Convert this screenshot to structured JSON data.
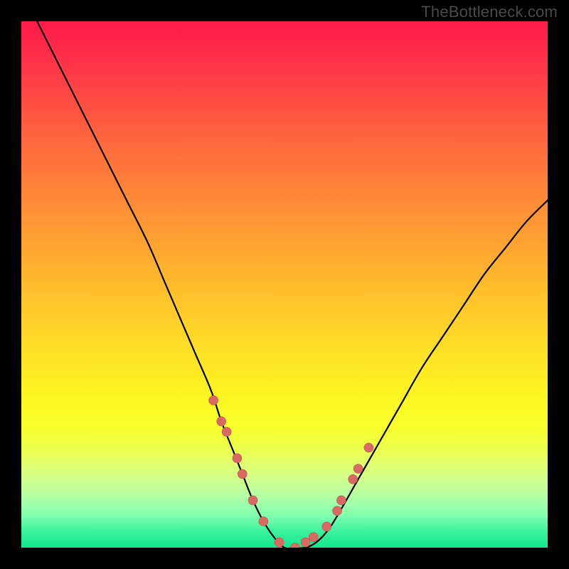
{
  "watermark": {
    "text": "TheBottleneck.com"
  },
  "colors": {
    "curve_stroke": "#000000",
    "marker_fill": "#d96a63",
    "marker_stroke": "#b75550"
  },
  "chart_data": {
    "type": "line",
    "title": "",
    "xlabel": "",
    "ylabel": "",
    "xlim": [
      0,
      100
    ],
    "ylim": [
      0,
      100
    ],
    "grid": false,
    "series": [
      {
        "name": "bottleneck-curve",
        "x": [
          3,
          8,
          12,
          16,
          20,
          24,
          27,
          30,
          33,
          36,
          38,
          40,
          42,
          44,
          46,
          48,
          50,
          52,
          54,
          56,
          58,
          60,
          64,
          68,
          72,
          76,
          80,
          84,
          88,
          92,
          96,
          100
        ],
        "y": [
          100,
          90,
          82,
          74,
          66,
          58,
          51,
          44,
          37,
          30,
          24,
          19,
          14,
          9,
          5,
          2,
          0,
          0,
          0,
          1,
          3,
          6,
          13,
          20,
          27,
          34,
          40,
          46,
          52,
          57,
          62,
          66
        ]
      }
    ],
    "markers": {
      "name": "highlight-points",
      "x": [
        36.5,
        38,
        39,
        41,
        42,
        44,
        46,
        49,
        52,
        54,
        55.5,
        58,
        60,
        60.8,
        63,
        64,
        66
      ],
      "y": [
        28,
        24,
        22,
        17,
        14,
        9,
        5,
        1,
        0,
        1,
        2,
        4,
        7,
        9,
        13,
        15,
        19
      ]
    }
  }
}
